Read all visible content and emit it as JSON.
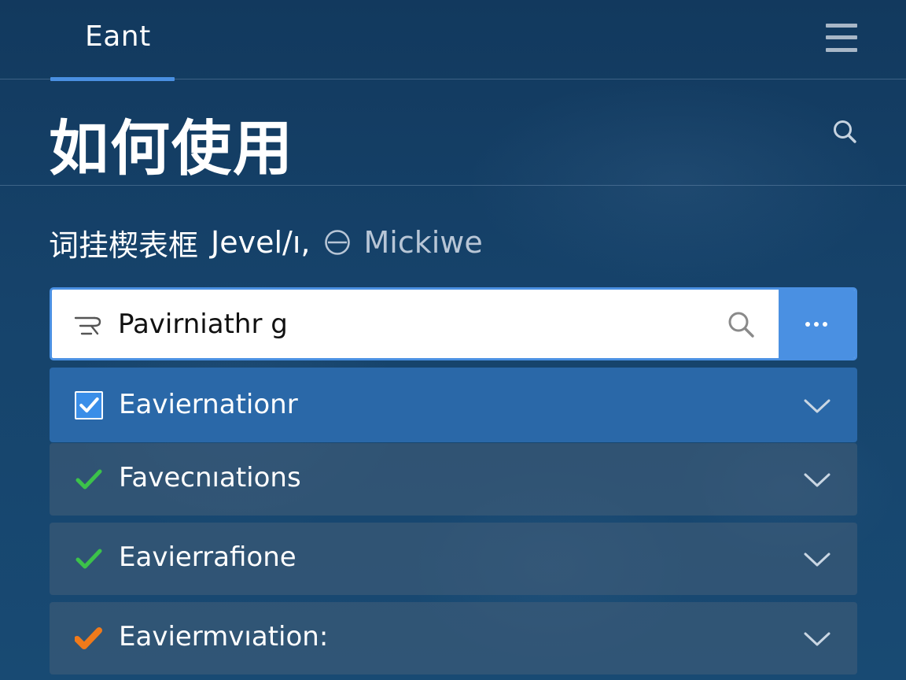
{
  "header": {
    "tab_label": "Eant",
    "menu_icon": "menu-icon"
  },
  "title": {
    "text": "如何使用",
    "search_icon": "search-icon"
  },
  "subtitle": {
    "main": "词挂楔表框",
    "secondary": "Jevel/ı,",
    "icon": "circle-minus-icon",
    "user": "Mickiwe"
  },
  "search": {
    "value": "Pavirniathr g",
    "filter_icon": "filter-icon",
    "search_icon": "search-icon",
    "more_icon": "more-horizontal-icon"
  },
  "list": {
    "items": [
      {
        "label": "Eaviernationr",
        "status": "checked-box",
        "selected": true
      },
      {
        "label": "Favecnıations",
        "status": "check-green",
        "selected": false
      },
      {
        "label": "Eavierrafione",
        "status": "check-green",
        "selected": false
      },
      {
        "label": "Eaviermvıation:",
        "status": "check-orange",
        "selected": false
      }
    ]
  },
  "colors": {
    "accent": "#4a90e2",
    "selected_row": "#2a68a8",
    "check_green": "#3cc24a",
    "check_orange": "#f07a1a",
    "background": "#16436b"
  }
}
